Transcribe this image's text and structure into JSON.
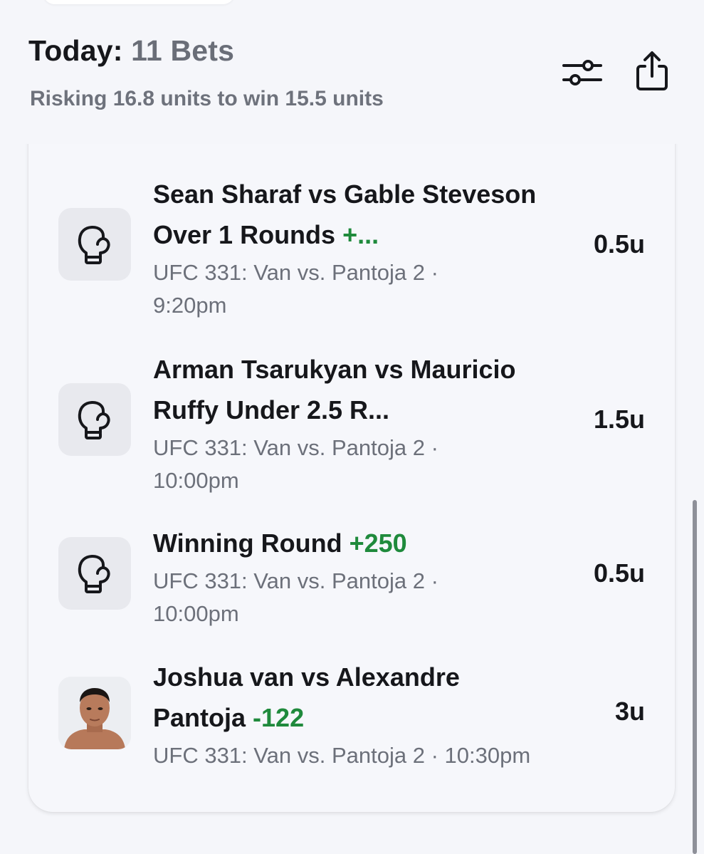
{
  "header": {
    "title_prefix": "Today: ",
    "bet_count_label": "11 Bets",
    "subtitle": "Risking 16.8 units to win 15.5 units"
  },
  "toolbar": {
    "filter_icon": "sliders-icon",
    "share_icon": "share-icon"
  },
  "colors": {
    "odds_green": "#1f8a3c",
    "secondary_text": "#6c707a"
  },
  "bets": [
    {
      "title": "Sean Sharaf vs Gable Steveson Over 1 Rounds",
      "odds": "+...",
      "meta": "UFC 331: Van vs. Pantoja 2 · 9:20pm",
      "units": "0.5u",
      "icon": "boxing-glove-icon"
    },
    {
      "title": "Arman Tsarukyan vs Mauricio Ruffy Under 2.5 R...",
      "odds": "",
      "meta": "UFC 331: Van vs. Pantoja 2 · 10:00pm",
      "units": "1.5u",
      "icon": "boxing-glove-icon"
    },
    {
      "title": "Winning Round",
      "odds": "+250",
      "meta": "UFC 331: Van vs. Pantoja 2 · 10:00pm",
      "units": "0.5u",
      "icon": "boxing-glove-icon"
    },
    {
      "title": "Joshua van vs Alexandre Pantoja",
      "odds": "-122",
      "meta": "UFC 331: Van vs. Pantoja 2 · 10:30pm",
      "units": "3u",
      "icon": "fighter-avatar"
    }
  ]
}
